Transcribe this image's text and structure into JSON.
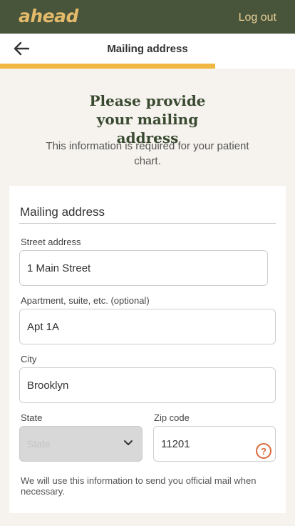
{
  "header": {
    "logo": "ahead",
    "logout_label": "Log out"
  },
  "nav": {
    "title": "Mailing address",
    "back_icon": "arrow-left-icon"
  },
  "progress": {
    "fraction": 0.73,
    "color": "#f0b843"
  },
  "intro": {
    "heading": "Please provide your mailing address",
    "subtext": "This information is required for your patient chart."
  },
  "form": {
    "section_title": "Mailing address",
    "street": {
      "label": "Street address",
      "value": "1 Main Street"
    },
    "apartment": {
      "label": "Apartment, suite, etc. (optional)",
      "value": "Apt 1A"
    },
    "city": {
      "label": "City",
      "value": "Brooklyn"
    },
    "state": {
      "label": "State",
      "placeholder": "State"
    },
    "zip": {
      "label": "Zip code",
      "value": "11201"
    },
    "help_icon": "question-circle-icon",
    "note": "We will use this information to send you official mail when necessary."
  },
  "colors": {
    "brand_green": "#48553a",
    "logo_gold": "#e3b96a",
    "accent_orange": "#d86a3c"
  }
}
